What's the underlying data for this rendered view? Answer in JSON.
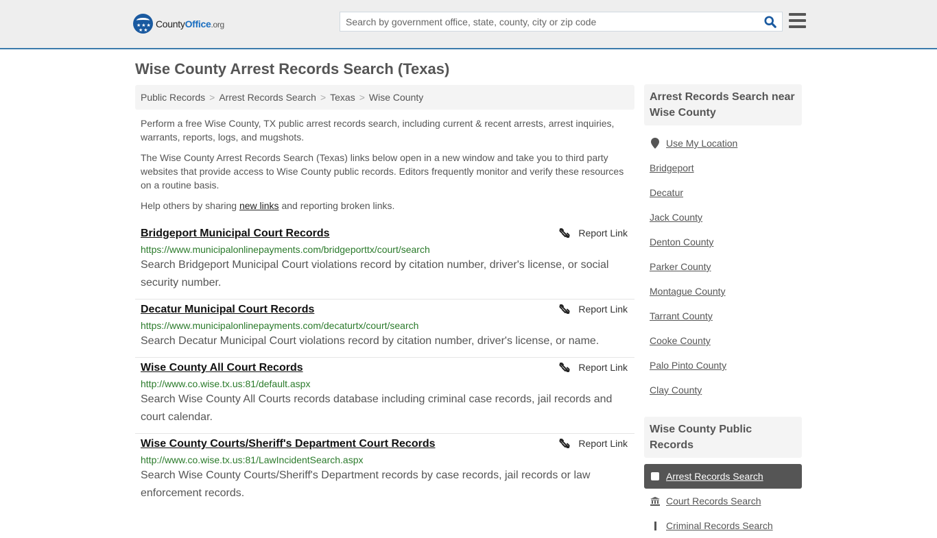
{
  "header": {
    "logo": {
      "name_part1": "County",
      "name_part2": "Office",
      "suffix": ".org"
    },
    "search_placeholder": "Search by government office, state, county, city or zip code",
    "search_value": ""
  },
  "page_title": "Wise County Arrest Records Search (Texas)",
  "breadcrumb": [
    "Public Records",
    "Arrest Records Search",
    "Texas",
    "Wise County"
  ],
  "intro": {
    "p1": "Perform a free Wise County, TX public arrest records search, including current & recent arrests, arrest inquiries, warrants, reports, logs, and mugshots.",
    "p2": "The Wise County Arrest Records Search (Texas) links below open in a new window and take you to third party websites that provide access to Wise County public records. Editors frequently monitor and verify these resources on a routine basis.",
    "p3_before": "Help others by sharing ",
    "p3_link": "new links",
    "p3_after": " and reporting broken links."
  },
  "report_label": "Report Link",
  "results": [
    {
      "title": "Bridgeport Municipal Court Records",
      "url": "https://www.municipalonlinepayments.com/bridgeporttx/court/search",
      "description": "Search Bridgeport Municipal Court violations record by citation number, driver's license, or social security number."
    },
    {
      "title": "Decatur Municipal Court Records",
      "url": "https://www.municipalonlinepayments.com/decaturtx/court/search",
      "description": "Search Decatur Municipal Court violations record by citation number, driver's license, or name."
    },
    {
      "title": "Wise County All Court Records",
      "url": "http://www.co.wise.tx.us:81/default.aspx",
      "description": "Search Wise County All Courts records database including criminal case records, jail records and court calendar."
    },
    {
      "title": "Wise County Courts/Sheriff's Department Court Records",
      "url": "http://www.co.wise.tx.us:81/LawIncidentSearch.aspx",
      "description": "Search Wise County Courts/Sheriff's Department records by case records, jail records or law enforcement records."
    }
  ],
  "sidebar": {
    "nearby_heading": "Arrest Records Search near Wise County",
    "use_location": "Use My Location",
    "nearby": [
      "Bridgeport",
      "Decatur",
      "Jack County",
      "Denton County",
      "Parker County",
      "Montague County",
      "Tarrant County",
      "Cooke County",
      "Palo Pinto County",
      "Clay County"
    ],
    "public_heading": "Wise County Public Records",
    "public_records": [
      {
        "label": "Arrest Records Search",
        "icon": "square-icon",
        "active": true
      },
      {
        "label": "Court Records Search",
        "icon": "courthouse-icon",
        "active": false
      },
      {
        "label": "Criminal Records Search",
        "icon": "exclamation-icon",
        "active": false
      }
    ]
  },
  "colors": {
    "header_border": "#3a7aab",
    "brand_blue": "#1a6ec0",
    "url_green": "#2a7a2a",
    "active_bg": "#555555"
  }
}
